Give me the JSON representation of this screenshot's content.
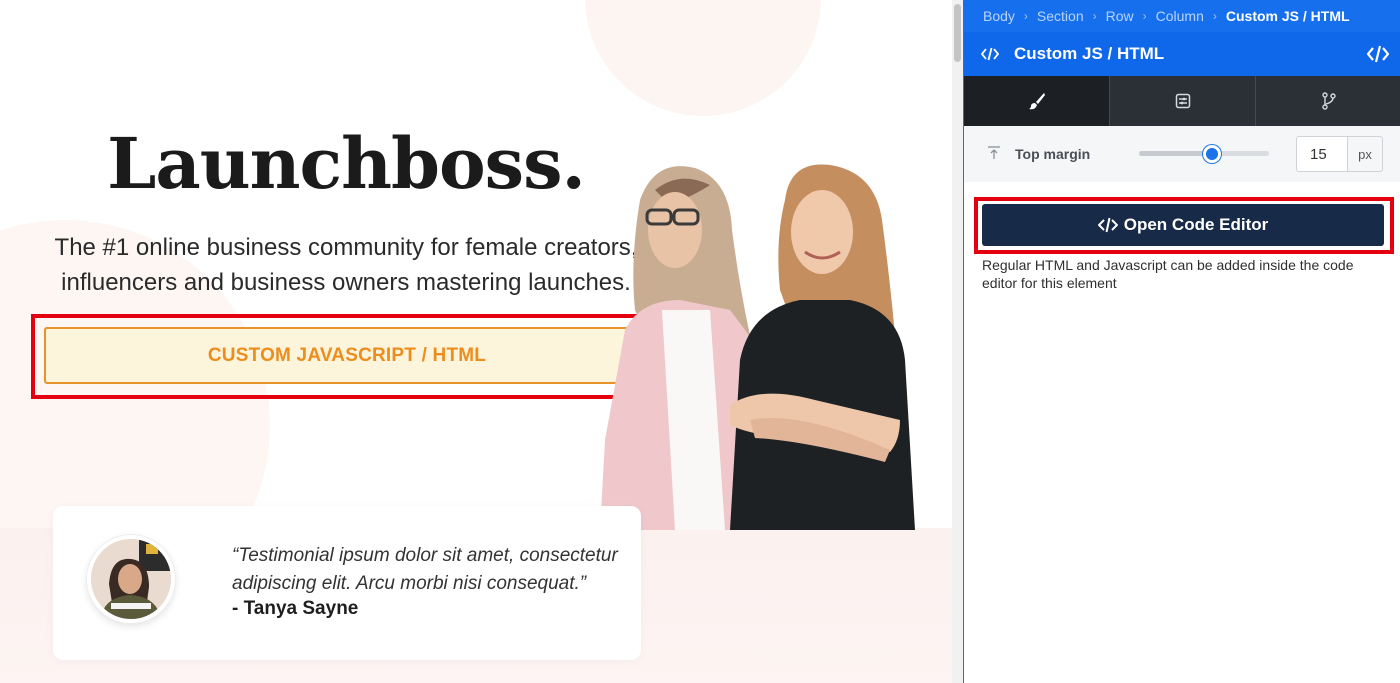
{
  "canvas": {
    "title": "Launchboss.",
    "tagline_line1": "The #1 online business community for female creators,",
    "tagline_line2": "influencers and business owners mastering launches.",
    "cta_label": "CUSTOM JAVASCRIPT / HTML",
    "testimonial": {
      "quote_line1": "“Testimonial ipsum dolor sit amet, consectetur",
      "quote_line2": "adipiscing elit. Arcu morbi nisi consequat.”",
      "author": "- Tanya Sayne"
    }
  },
  "panel": {
    "breadcrumb": [
      "Body",
      "Section",
      "Row",
      "Column",
      "Custom JS / HTML"
    ],
    "element_title": "Custom JS / HTML",
    "tabs": [
      {
        "icon": "brush-icon",
        "active": true
      },
      {
        "icon": "settings-panel-icon",
        "active": false
      },
      {
        "icon": "git-branch-icon",
        "active": false
      }
    ],
    "top_margin": {
      "label": "Top margin",
      "value": "15",
      "unit": "px",
      "slider_fraction": 0.56
    },
    "open_editor_label": "Open Code Editor",
    "help_text": "Regular HTML and Javascript can be added inside the code editor for this element"
  },
  "colors": {
    "accent_blue": "#1670ee",
    "header_blue": "#0f67ea",
    "cta_orange": "#ec8d1e",
    "highlight_red": "#e4000f",
    "editor_button": "#172a48"
  }
}
